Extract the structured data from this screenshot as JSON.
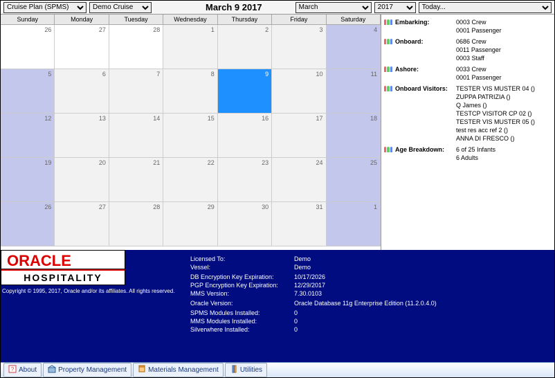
{
  "toolbar": {
    "plan_select": "Cruise Plan (SPMS)",
    "cruise_select": "Demo Cruise",
    "date_title": "March 9 2017",
    "month_select": "March",
    "year_select": "2017",
    "today_select": "Today..."
  },
  "calendar": {
    "days": [
      "Sunday",
      "Monday",
      "Tuesday",
      "Wednesday",
      "Thursday",
      "Friday",
      "Saturday"
    ],
    "cells": [
      {
        "t": "26",
        "cls": "we empty"
      },
      {
        "t": "27",
        "cls": "empty"
      },
      {
        "t": "28",
        "cls": "empty"
      },
      {
        "t": "1",
        "cls": ""
      },
      {
        "t": "2",
        "cls": ""
      },
      {
        "t": "3",
        "cls": ""
      },
      {
        "t": "4",
        "cls": "we"
      },
      {
        "t": "5",
        "cls": "we"
      },
      {
        "t": "6",
        "cls": ""
      },
      {
        "t": "7",
        "cls": ""
      },
      {
        "t": "8",
        "cls": ""
      },
      {
        "t": "9",
        "cls": "selected"
      },
      {
        "t": "10",
        "cls": ""
      },
      {
        "t": "11",
        "cls": "we"
      },
      {
        "t": "12",
        "cls": "we"
      },
      {
        "t": "13",
        "cls": ""
      },
      {
        "t": "14",
        "cls": ""
      },
      {
        "t": "15",
        "cls": ""
      },
      {
        "t": "16",
        "cls": ""
      },
      {
        "t": "17",
        "cls": ""
      },
      {
        "t": "18",
        "cls": "we"
      },
      {
        "t": "19",
        "cls": "we"
      },
      {
        "t": "20",
        "cls": ""
      },
      {
        "t": "21",
        "cls": ""
      },
      {
        "t": "22",
        "cls": ""
      },
      {
        "t": "23",
        "cls": ""
      },
      {
        "t": "24",
        "cls": ""
      },
      {
        "t": "25",
        "cls": "we"
      },
      {
        "t": "26",
        "cls": "we"
      },
      {
        "t": "27",
        "cls": ""
      },
      {
        "t": "28",
        "cls": ""
      },
      {
        "t": "29",
        "cls": ""
      },
      {
        "t": "30",
        "cls": ""
      },
      {
        "t": "31",
        "cls": ""
      },
      {
        "t": "1",
        "cls": "we"
      }
    ]
  },
  "stats": [
    {
      "label": "Embarking:",
      "vals": [
        "0003 Crew",
        "0001 Passenger"
      ]
    },
    {
      "label": "Onboard:",
      "vals": [
        "0686 Crew",
        "0011 Passenger",
        "0003 Staff"
      ]
    },
    {
      "label": "Ashore:",
      "vals": [
        "0033 Crew",
        "0001 Passenger"
      ]
    },
    {
      "label": "Onboard Visitors:",
      "vals": [
        "TESTER VIS MUSTER 04 ()",
        "ZUPPA PATRIZIA ()",
        "Q James ()",
        "TESTCP VISITOR CP 02 ()",
        "TESTER VIS MUSTER 05 ()",
        "test res acc ref 2 ()",
        "ANNA DI FRESCO ()"
      ]
    },
    {
      "label": "Age Breakdown:",
      "vals": [
        "6 of 25 Infants",
        "6  Adults"
      ]
    }
  ],
  "footer": {
    "logo_top": "ORACLE",
    "logo_sub": "HOSPITALITY",
    "copyright": "Copyright © 1995, 2017, Oracle and/or its affiliates. All rights reserved.",
    "rows": [
      {
        "k": "Licensed To:",
        "v": "Demo"
      },
      {
        "k": "Vessel:",
        "v": "Demo"
      },
      {
        "k": "",
        "v": ""
      },
      {
        "k": "DB Encryption Key Expiration:",
        "v": "10/17/2026"
      },
      {
        "k": "PGP Encryption Key Expiration:",
        "v": "12/29/2017"
      },
      {
        "k": "MMS Version:",
        "v": "7.30.0103"
      },
      {
        "k": "",
        "v": ""
      },
      {
        "k": "Oracle Version:",
        "v": "Oracle Database 11g Enterprise Edition (11.2.0.4.0)"
      },
      {
        "k": "",
        "v": ""
      },
      {
        "k": "SPMS Modules Installed:",
        "v": "0"
      },
      {
        "k": "MMS Modules Installed:",
        "v": "0"
      },
      {
        "k": "Silverwhere Installed:",
        "v": "0"
      }
    ]
  },
  "tabs": [
    "About",
    "Property Management",
    "Materials Management",
    "Utilities"
  ],
  "chart_data": {
    "type": "table",
    "title": "Cruise Status March 9 2017",
    "series": [
      {
        "name": "Embarking",
        "categories": [
          "Crew",
          "Passenger"
        ],
        "values": [
          3,
          1
        ]
      },
      {
        "name": "Onboard",
        "categories": [
          "Crew",
          "Passenger",
          "Staff"
        ],
        "values": [
          686,
          11,
          3
        ]
      },
      {
        "name": "Ashore",
        "categories": [
          "Crew",
          "Passenger"
        ],
        "values": [
          33,
          1
        ]
      },
      {
        "name": "Age Breakdown",
        "categories": [
          "Infants",
          "Adults"
        ],
        "values": [
          6,
          6
        ],
        "notes": "6 of 25 Infants"
      }
    ]
  }
}
